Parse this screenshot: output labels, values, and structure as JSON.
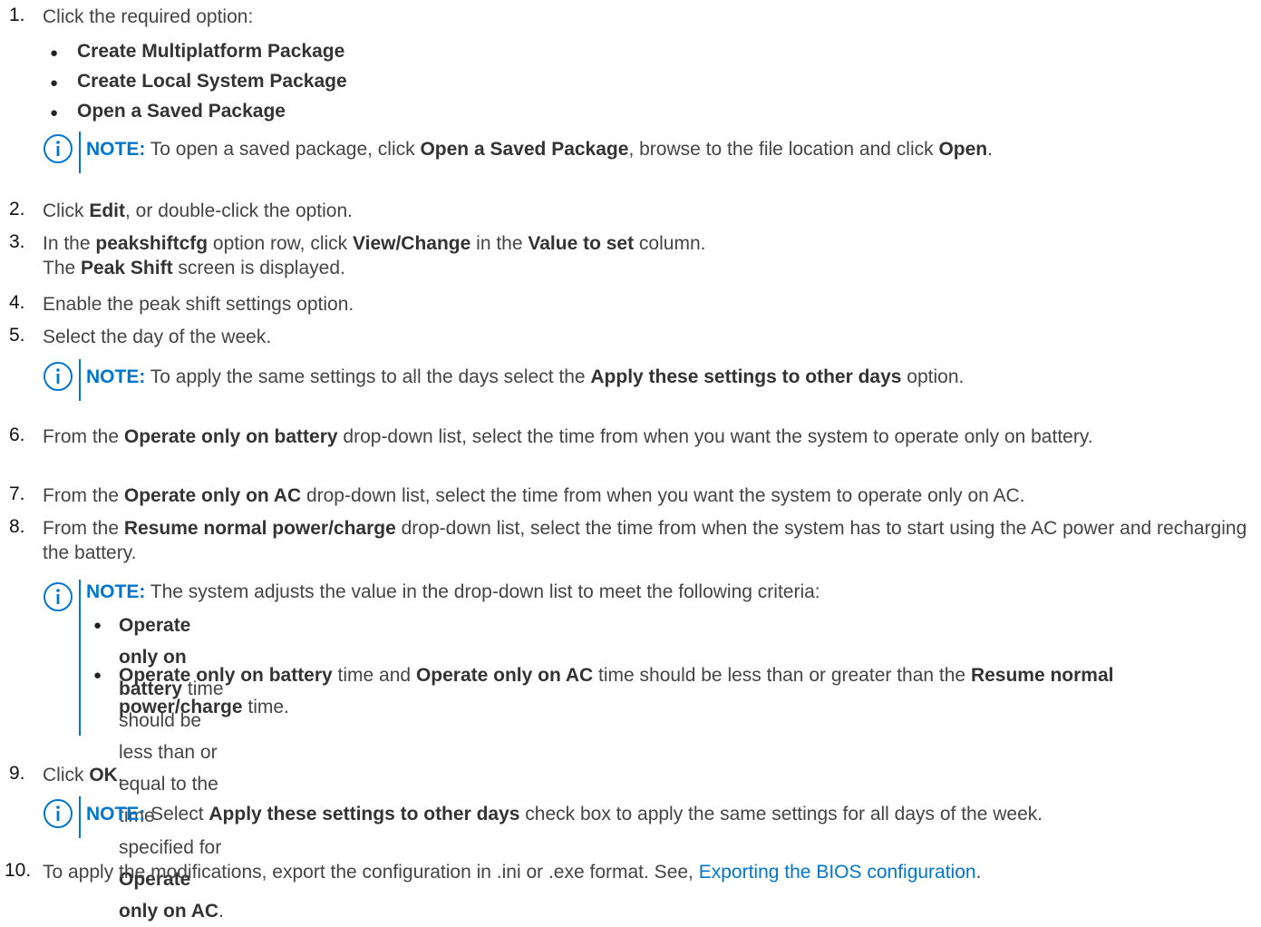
{
  "steps": [
    {
      "num": "1.",
      "text": "Click the required option:"
    },
    {
      "num": "2.",
      "pre": "Click ",
      "b1": "Edit",
      "post": ", or double-click the option."
    },
    {
      "num": "3.",
      "pre": "In the ",
      "b1": "peakshiftcfg",
      "mid1": " option row, click ",
      "b2": "View/Change",
      "mid2": " in the ",
      "b3": "Value to set",
      "post": " column.",
      "line2_pre": "The ",
      "line2_b": "Peak Shift",
      "line2_post": " screen is displayed."
    },
    {
      "num": "4.",
      "text": "Enable the peak shift settings option."
    },
    {
      "num": "5.",
      "text": "Select the day of the week."
    },
    {
      "num": "6.",
      "pre": "From the ",
      "b1": "Operate only on battery",
      "post": " drop-down list, select the time from when you want the system to operate only on battery."
    },
    {
      "num": "7.",
      "pre": "From the ",
      "b1": "Operate only on AC",
      "post": " drop-down list, select the time from when you want the system to operate only on AC."
    },
    {
      "num": "8.",
      "pre": "From the ",
      "b1": "Resume normal power/charge",
      "post": " drop-down list, select the time from when the system has to start using the AC power and recharging the battery."
    },
    {
      "num": "9.",
      "pre": "Click ",
      "b1": "OK",
      "post": "."
    },
    {
      "num": "10.",
      "pre": "To apply the modifications, export the configuration in .ini or .exe format. See, ",
      "link": "Exporting the BIOS configuration",
      "post": "."
    }
  ],
  "options": [
    "Create Multiplatform Package",
    "Create Local System Package",
    "Open a Saved Package"
  ],
  "note_label": "NOTE:",
  "notes": {
    "n1": {
      "pre": " To open a saved package, click ",
      "b1": "Open a Saved Package",
      "mid": ", browse to the file location and click ",
      "b2": "Open",
      "post": "."
    },
    "n2": {
      "pre": " To apply the same settings to all the days select the ",
      "b1": "Apply these settings to other days",
      "post": " option."
    },
    "n3": {
      "intro": " The system adjusts the value in the drop-down list to meet the following criteria:",
      "b1_pre": "Operate only on battery",
      "b1_mid": " time should be less than or equal to the time specified for ",
      "b1_b2": "Operate only on AC",
      "b1_post": ".",
      "b2_pre": "Operate only on battery",
      "b2_mid1": " time and ",
      "b2_b2": "Operate only on AC",
      "b2_mid2": " time should be less than or greater than the ",
      "b2_b3": "Resume normal power/charge",
      "b2_post": " time."
    },
    "n4": {
      "pre": " Select ",
      "b1": "Apply these settings to other days",
      "post": " check box to apply the same settings for all days of the week."
    }
  },
  "bullet_glyph": "●",
  "colors": {
    "accent": "#0076ce",
    "text": "#444444"
  }
}
